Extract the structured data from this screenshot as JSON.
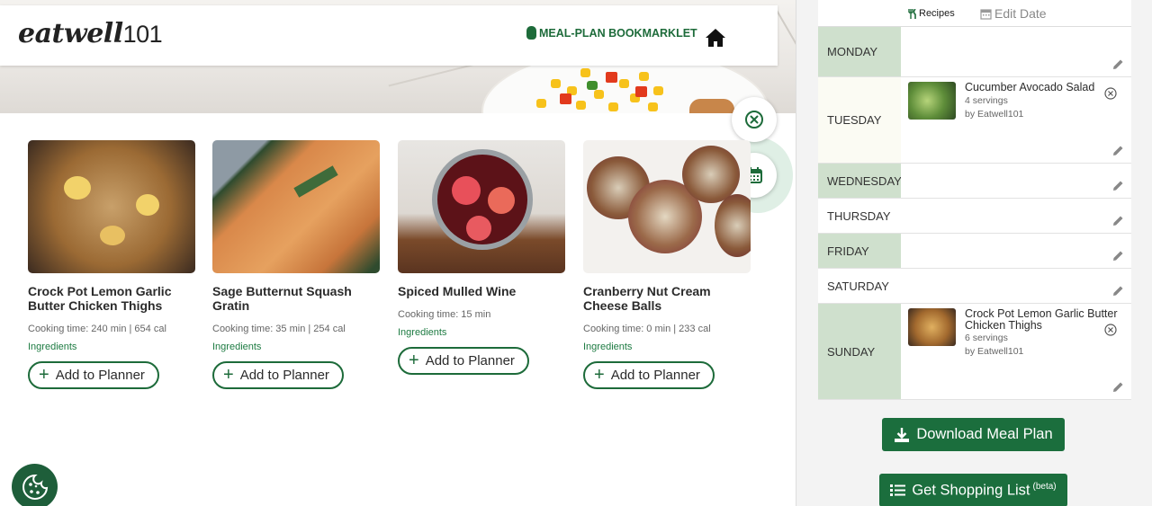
{
  "header": {
    "logo_word": "eatwell",
    "logo_num": "101",
    "bookmarklet_label": "MEAL-PLAN BOOKMARKLET",
    "home_icon": "home-icon"
  },
  "float_buttons": {
    "close_icon": "close-circle-icon",
    "calendar_icon": "calendar-icon"
  },
  "recipes": [
    {
      "title": "Crock Pot Lemon Garlic Butter Chicken Thighs",
      "meta": "Cooking time: 240 min  | 654 cal",
      "ingredients": "Ingredients",
      "add_label": "Add to Planner"
    },
    {
      "title": "Sage Butternut Squash Gratin",
      "meta": "Cooking time: 35 min  | 254 cal",
      "ingredients": "Ingredients",
      "add_label": "Add to Planner"
    },
    {
      "title": "Spiced Mulled Wine",
      "meta": "Cooking time: 15 min",
      "ingredients": "Ingredients",
      "add_label": "Add to Planner"
    },
    {
      "title": "Cranberry Nut Cream Cheese Balls",
      "meta": "Cooking time: 0 min  | 233 cal",
      "ingredients": "Ingredients",
      "add_label": "Add to Planner"
    }
  ],
  "cookie": {
    "icon": "cookie-icon"
  },
  "planner": {
    "tab_recipes": "Recipes",
    "tab_edit_date": "Edit Date",
    "days": [
      {
        "label": "MONDAY"
      },
      {
        "label": "TUESDAY",
        "entry": {
          "title": "Cucumber Avocado Salad",
          "servings": "4 servings",
          "author": "by Eatwell101"
        }
      },
      {
        "label": "WEDNESDAY"
      },
      {
        "label": "THURSDAY"
      },
      {
        "label": "FRIDAY"
      },
      {
        "label": "SATURDAY"
      },
      {
        "label": "SUNDAY",
        "entry": {
          "title": "Crock Pot Lemon Garlic Butter Chicken Thighs",
          "servings": "6 servings",
          "author": "by Eatwell101"
        }
      }
    ],
    "download_label": "Download Meal Plan",
    "shopping_label": "Get Shopping List",
    "shopping_sup": "(beta)"
  },
  "colors": {
    "brand_green": "#1b6e3d",
    "day_green": "#cfe0cd",
    "link_green": "#1d7b42"
  }
}
